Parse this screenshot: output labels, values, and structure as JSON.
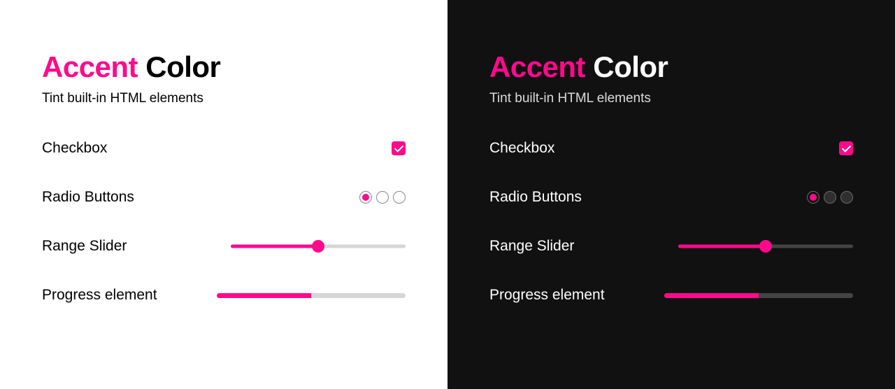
{
  "accent_color": "#ff0a8b",
  "header": {
    "title_accent": "Accent",
    "title_rest": "Color",
    "subtitle": "Tint built-in HTML elements"
  },
  "rows": {
    "checkbox": {
      "label": "Checkbox",
      "checked": true
    },
    "radio": {
      "label": "Radio Buttons",
      "options": 3,
      "selected_index": 0
    },
    "range": {
      "label": "Range Slider",
      "value": 50,
      "min": 0,
      "max": 100
    },
    "progress": {
      "label": "Progress element",
      "value": 50,
      "max": 100
    }
  }
}
